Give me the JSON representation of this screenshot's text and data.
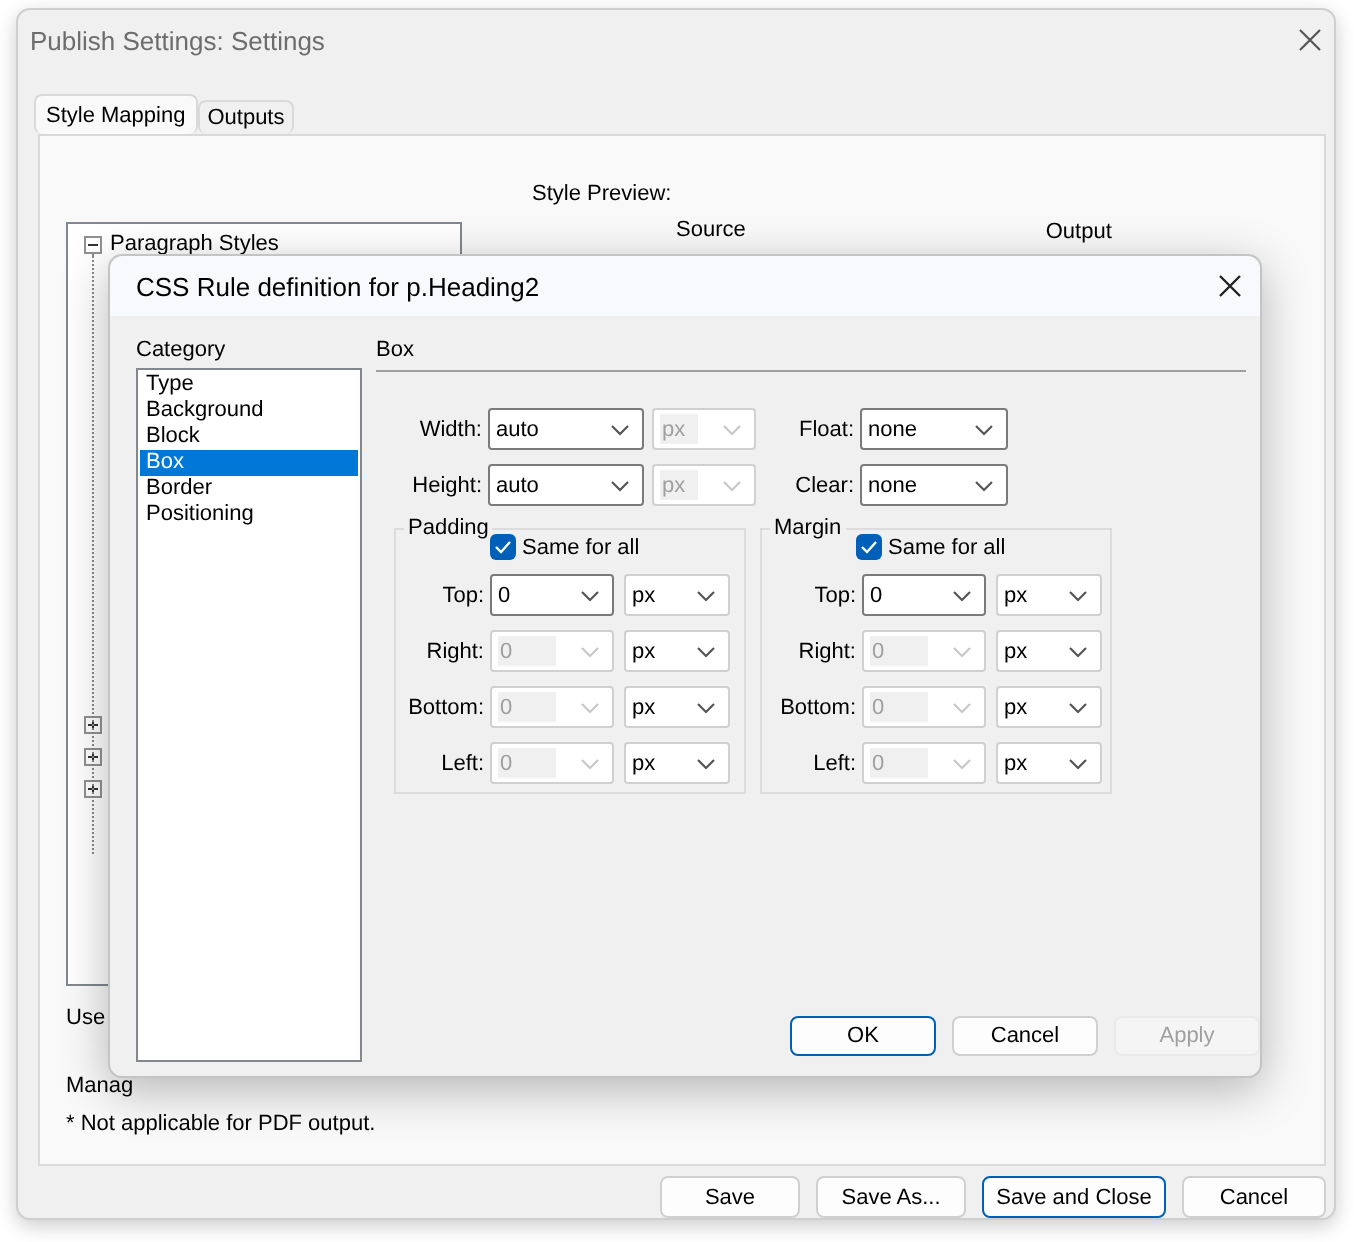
{
  "window": {
    "title": "Publish Settings: Settings"
  },
  "tabs": [
    {
      "label": "Style Mapping",
      "selected": true
    },
    {
      "label": "Outputs",
      "selected": false
    }
  ],
  "style_preview": {
    "label": "Style Preview:",
    "columns": [
      "Source",
      "Output"
    ]
  },
  "tree": {
    "items": [
      {
        "label": "Paragraph Styles",
        "expanded": true
      },
      {
        "expanded": false
      },
      {
        "expanded": false
      },
      {
        "expanded": false
      }
    ]
  },
  "option_1_label": "Use",
  "option_2_label": "Manag",
  "note": "* Not applicable for PDF output.",
  "buttons": [
    {
      "label": "Save",
      "default": false
    },
    {
      "label": "Save As...",
      "default": false
    },
    {
      "label": "Save and Close",
      "default": true
    },
    {
      "label": "Cancel",
      "default": false
    }
  ],
  "css_dialog": {
    "title": "CSS Rule definition for p.Heading2",
    "category_label": "Category",
    "categories": [
      {
        "label": "Type",
        "selected": false
      },
      {
        "label": "Background",
        "selected": false
      },
      {
        "label": "Block",
        "selected": false
      },
      {
        "label": "Box",
        "selected": true
      },
      {
        "label": "Border",
        "selected": false
      },
      {
        "label": "Positioning",
        "selected": false
      }
    ],
    "section_title": "Box",
    "size_rows": [
      {
        "label": "Width:",
        "value": "auto",
        "unit": "px",
        "unit_disabled": true,
        "side_label": "Float:",
        "side_value": "none"
      },
      {
        "label": "Height:",
        "value": "auto",
        "unit": "px",
        "unit_disabled": true,
        "side_label": "Clear:",
        "side_value": "none"
      }
    ],
    "groups": [
      {
        "title": "Padding",
        "same_for_all": {
          "label": "Same for all",
          "checked": true
        },
        "rows": [
          {
            "label": "Top:",
            "value": "0",
            "unit": "px",
            "disabled": false
          },
          {
            "label": "Right:",
            "value": "0",
            "unit": "px",
            "disabled": true
          },
          {
            "label": "Bottom:",
            "value": "0",
            "unit": "px",
            "disabled": true
          },
          {
            "label": "Left:",
            "value": "0",
            "unit": "px",
            "disabled": true
          }
        ]
      },
      {
        "title": "Margin",
        "same_for_all": {
          "label": "Same for all",
          "checked": true
        },
        "rows": [
          {
            "label": "Top:",
            "value": "0",
            "unit": "px",
            "disabled": false
          },
          {
            "label": "Right:",
            "value": "0",
            "unit": "px",
            "disabled": true
          },
          {
            "label": "Bottom:",
            "value": "0",
            "unit": "px",
            "disabled": true
          },
          {
            "label": "Left:",
            "value": "0",
            "unit": "px",
            "disabled": true
          }
        ]
      }
    ],
    "buttons": [
      {
        "label": "OK",
        "default": true,
        "disabled": false
      },
      {
        "label": "Cancel",
        "default": false,
        "disabled": false
      },
      {
        "label": "Apply",
        "default": false,
        "disabled": true
      }
    ]
  }
}
